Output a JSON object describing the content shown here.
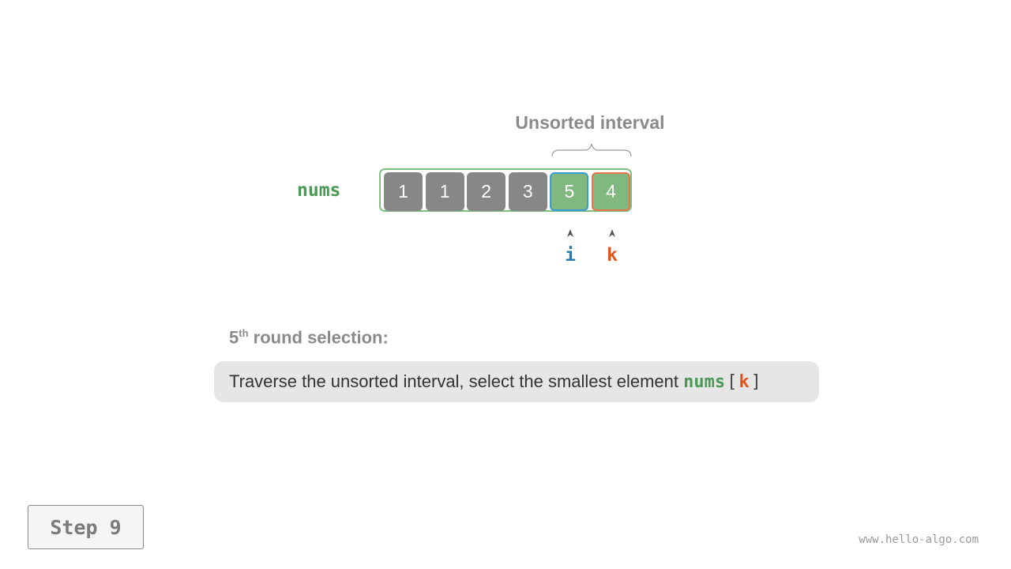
{
  "interval_label": "Unsorted interval",
  "array": {
    "label": "nums",
    "values": [
      "1",
      "1",
      "2",
      "3",
      "5",
      "4"
    ],
    "states": [
      "sorted",
      "sorted",
      "sorted",
      "sorted",
      "unsorted",
      "unsorted"
    ]
  },
  "pointers": {
    "i": {
      "label": "i",
      "index": 4,
      "color": "#1f7fb5"
    },
    "k": {
      "label": "k",
      "index": 5,
      "color": "#e0541f"
    }
  },
  "round": {
    "number": "5",
    "suffix": "th",
    "text": " round selection:"
  },
  "description": {
    "text": "Traverse the unsorted interval, select the smallest element ",
    "code_var": "nums",
    "open_bracket": "[",
    "code_index": "k",
    "close_bracket": "]"
  },
  "step_label": "Step 9",
  "watermark": "www.hello-algo.com",
  "colors": {
    "sorted": "#878787",
    "unsorted": "#80b87f",
    "array_border": "#7fbf7f",
    "label_green": "#4a9a55"
  }
}
